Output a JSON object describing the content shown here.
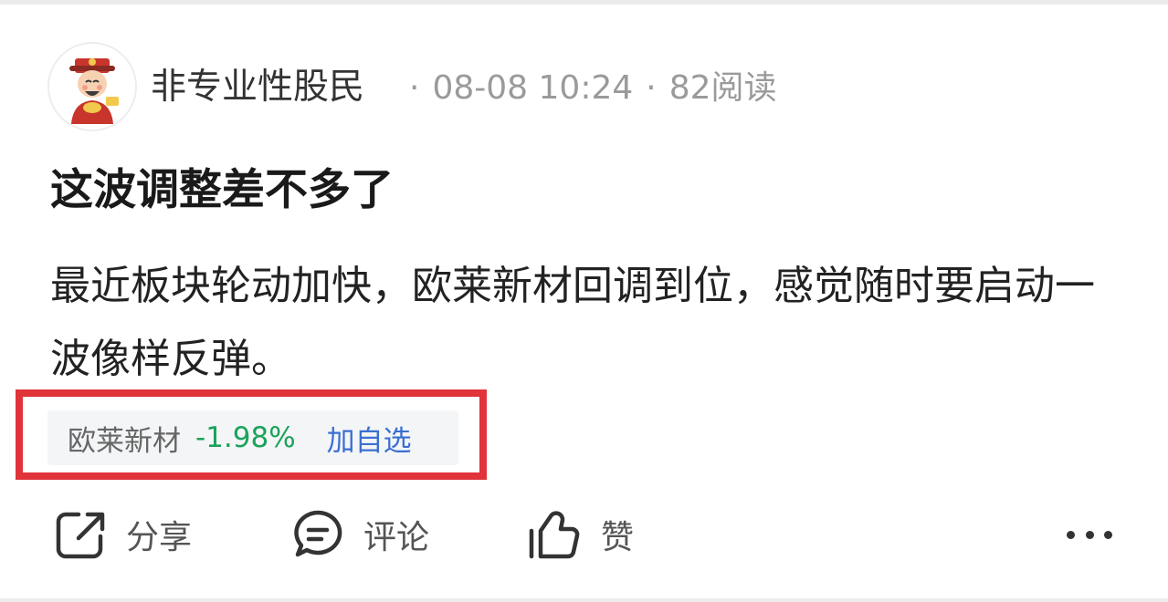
{
  "post": {
    "author": "非专业性股民",
    "time": "08-08 10:24",
    "reads": "82阅读",
    "separator": "·",
    "title": "这波调整差不多了",
    "content": "最近板块轮动加快，欧莱新材回调到位，感觉随时要启动一波像样反弹。"
  },
  "stock_chip": {
    "name": "欧莱新材",
    "change": "-1.98%",
    "add_label": "加自选"
  },
  "actions": {
    "share_label": "分享",
    "comment_label": "评论",
    "like_label": "赞"
  },
  "icons": {
    "avatar": "caishen-avatar",
    "share": "share-icon",
    "comment": "comment-icon",
    "like": "thumbs-up-icon",
    "more": "more-icon"
  },
  "colors": {
    "highlight": "#e0333a",
    "change_negative": "#1aa35a",
    "add_link": "#3b6fd1"
  }
}
